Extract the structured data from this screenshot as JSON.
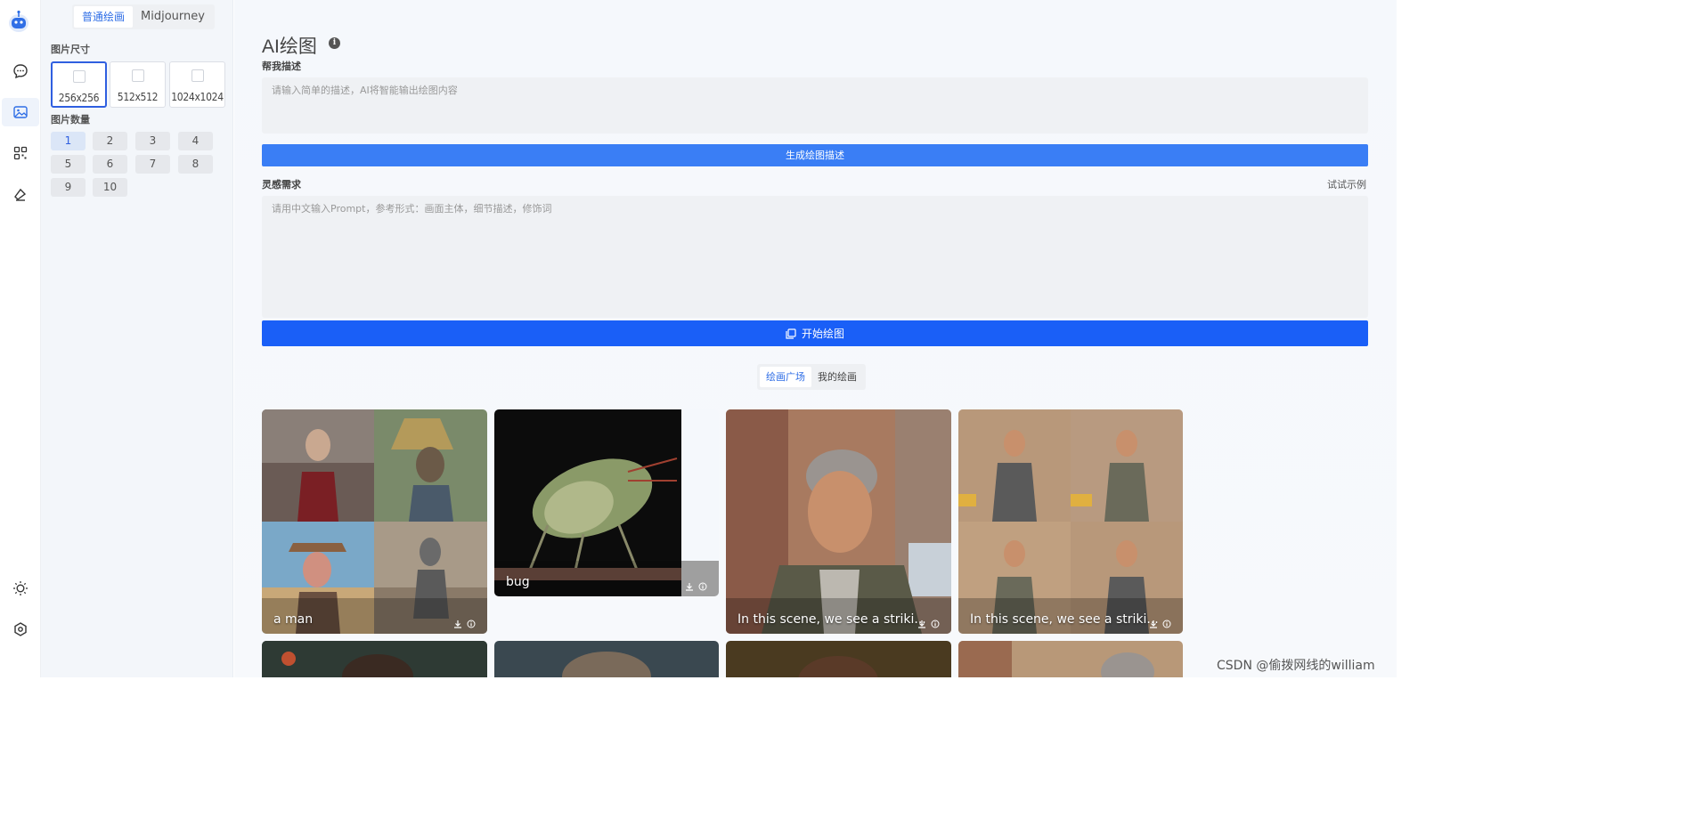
{
  "rail": {
    "items": [
      {
        "name": "chat-icon",
        "active": false
      },
      {
        "name": "image-gen-icon",
        "active": true
      },
      {
        "name": "apps-icon",
        "active": false
      },
      {
        "name": "brush-icon",
        "active": false
      }
    ],
    "bottom": [
      {
        "name": "theme-sun-icon"
      },
      {
        "name": "settings-icon"
      }
    ]
  },
  "panel": {
    "mode_tabs": [
      "普通绘画",
      "Midjourney"
    ],
    "size_label": "图片尺寸",
    "sizes": [
      "256x256",
      "512x512",
      "1024x1024"
    ],
    "count_label": "图片数量",
    "counts": [
      "1",
      "2",
      "3",
      "4",
      "5",
      "6",
      "7",
      "8",
      "9",
      "10"
    ]
  },
  "main": {
    "title": "AI绘图",
    "describe_label": "帮我描述",
    "describe_placeholder": "请输入简单的描述，AI将智能输出绘图内容",
    "generate_button": "生成绘图描述",
    "inspiration_label": "灵感需求",
    "try_example": "试试示例",
    "prompt_placeholder": "请用中文输入Prompt，参考形式：画面主体，细节描述，修饰词",
    "start_button": "开始绘图",
    "gallery_tabs": [
      "绘画广场",
      "我的绘画"
    ]
  },
  "gallery": [
    {
      "caption": "a man"
    },
    {
      "caption": "bug"
    },
    {
      "caption": "In this scene, we see a striki..."
    },
    {
      "caption": "In this scene, we see a striki..."
    }
  ],
  "watermark": "CSDN @偷拨网线的william",
  "colors": {
    "accent": "#2f5fe0",
    "button_primary": "#1a5ff7",
    "button_secondary": "#3a7ef5"
  }
}
